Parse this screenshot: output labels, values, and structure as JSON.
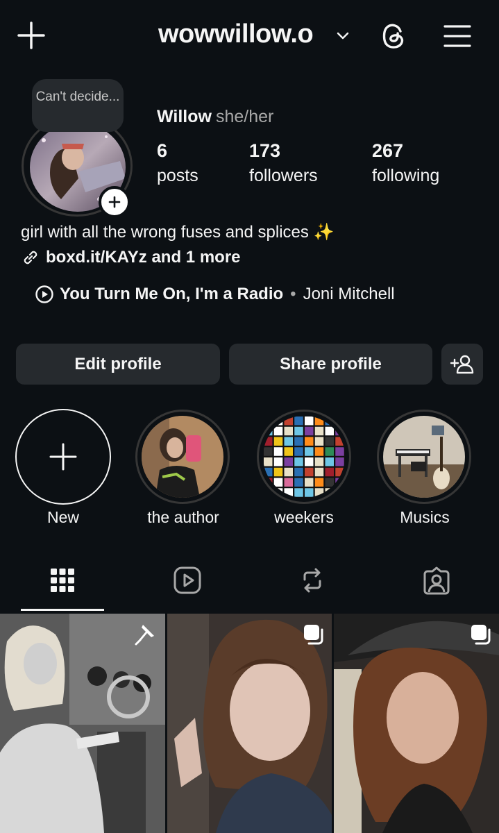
{
  "header": {
    "username": "wowwillow.o",
    "icons": [
      "plus-icon",
      "chevron-down-icon",
      "threads-icon",
      "menu-icon"
    ]
  },
  "profile": {
    "note": "Can't decide...",
    "name": "Willow",
    "pronouns": "she/her",
    "stats": [
      {
        "value": "6",
        "label": "posts"
      },
      {
        "value": "173",
        "label": "followers"
      },
      {
        "value": "267",
        "label": "following"
      }
    ],
    "bio": "girl with all the wrong fuses and splices ✨",
    "link": "boxd.it/KAYz and 1 more",
    "song": {
      "title": "You Turn Me On, I'm a Radio",
      "separator": "•",
      "artist": "Joni Mitchell"
    }
  },
  "buttons": {
    "edit": "Edit profile",
    "share": "Share profile"
  },
  "highlights": [
    {
      "label": "New"
    },
    {
      "label": "the author"
    },
    {
      "label": "weekers"
    },
    {
      "label": "Musics"
    }
  ],
  "tabs": [
    "grid-icon",
    "reels-icon",
    "reposts-icon",
    "tagged-icon"
  ],
  "posts": [
    {
      "badge": "pin-icon"
    },
    {
      "badge": "carousel-icon"
    },
    {
      "badge": "carousel-icon"
    }
  ],
  "colors": {
    "background": "#0c1014",
    "button": "#262a2e",
    "text": "#f5f5f5",
    "muted": "#a8a8a8"
  }
}
